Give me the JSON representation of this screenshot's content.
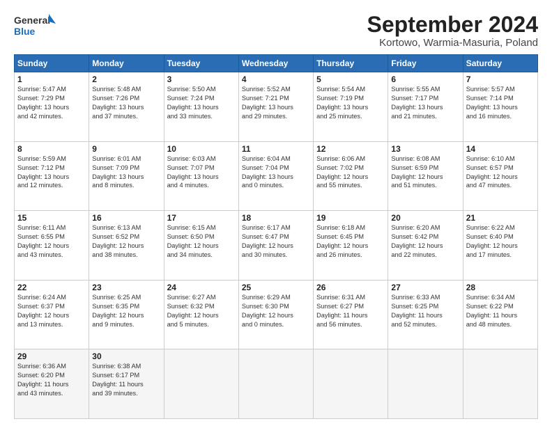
{
  "header": {
    "logo_line1": "General",
    "logo_line2": "Blue",
    "title": "September 2024",
    "subtitle": "Kortowo, Warmia-Masuria, Poland"
  },
  "weekdays": [
    "Sunday",
    "Monday",
    "Tuesday",
    "Wednesday",
    "Thursday",
    "Friday",
    "Saturday"
  ],
  "weeks": [
    [
      {
        "day": "1",
        "info": "Sunrise: 5:47 AM\nSunset: 7:29 PM\nDaylight: 13 hours\nand 42 minutes."
      },
      {
        "day": "2",
        "info": "Sunrise: 5:48 AM\nSunset: 7:26 PM\nDaylight: 13 hours\nand 37 minutes."
      },
      {
        "day": "3",
        "info": "Sunrise: 5:50 AM\nSunset: 7:24 PM\nDaylight: 13 hours\nand 33 minutes."
      },
      {
        "day": "4",
        "info": "Sunrise: 5:52 AM\nSunset: 7:21 PM\nDaylight: 13 hours\nand 29 minutes."
      },
      {
        "day": "5",
        "info": "Sunrise: 5:54 AM\nSunset: 7:19 PM\nDaylight: 13 hours\nand 25 minutes."
      },
      {
        "day": "6",
        "info": "Sunrise: 5:55 AM\nSunset: 7:17 PM\nDaylight: 13 hours\nand 21 minutes."
      },
      {
        "day": "7",
        "info": "Sunrise: 5:57 AM\nSunset: 7:14 PM\nDaylight: 13 hours\nand 16 minutes."
      }
    ],
    [
      {
        "day": "8",
        "info": "Sunrise: 5:59 AM\nSunset: 7:12 PM\nDaylight: 13 hours\nand 12 minutes."
      },
      {
        "day": "9",
        "info": "Sunrise: 6:01 AM\nSunset: 7:09 PM\nDaylight: 13 hours\nand 8 minutes."
      },
      {
        "day": "10",
        "info": "Sunrise: 6:03 AM\nSunset: 7:07 PM\nDaylight: 13 hours\nand 4 minutes."
      },
      {
        "day": "11",
        "info": "Sunrise: 6:04 AM\nSunset: 7:04 PM\nDaylight: 13 hours\nand 0 minutes."
      },
      {
        "day": "12",
        "info": "Sunrise: 6:06 AM\nSunset: 7:02 PM\nDaylight: 12 hours\nand 55 minutes."
      },
      {
        "day": "13",
        "info": "Sunrise: 6:08 AM\nSunset: 6:59 PM\nDaylight: 12 hours\nand 51 minutes."
      },
      {
        "day": "14",
        "info": "Sunrise: 6:10 AM\nSunset: 6:57 PM\nDaylight: 12 hours\nand 47 minutes."
      }
    ],
    [
      {
        "day": "15",
        "info": "Sunrise: 6:11 AM\nSunset: 6:55 PM\nDaylight: 12 hours\nand 43 minutes."
      },
      {
        "day": "16",
        "info": "Sunrise: 6:13 AM\nSunset: 6:52 PM\nDaylight: 12 hours\nand 38 minutes."
      },
      {
        "day": "17",
        "info": "Sunrise: 6:15 AM\nSunset: 6:50 PM\nDaylight: 12 hours\nand 34 minutes."
      },
      {
        "day": "18",
        "info": "Sunrise: 6:17 AM\nSunset: 6:47 PM\nDaylight: 12 hours\nand 30 minutes."
      },
      {
        "day": "19",
        "info": "Sunrise: 6:18 AM\nSunset: 6:45 PM\nDaylight: 12 hours\nand 26 minutes."
      },
      {
        "day": "20",
        "info": "Sunrise: 6:20 AM\nSunset: 6:42 PM\nDaylight: 12 hours\nand 22 minutes."
      },
      {
        "day": "21",
        "info": "Sunrise: 6:22 AM\nSunset: 6:40 PM\nDaylight: 12 hours\nand 17 minutes."
      }
    ],
    [
      {
        "day": "22",
        "info": "Sunrise: 6:24 AM\nSunset: 6:37 PM\nDaylight: 12 hours\nand 13 minutes."
      },
      {
        "day": "23",
        "info": "Sunrise: 6:25 AM\nSunset: 6:35 PM\nDaylight: 12 hours\nand 9 minutes."
      },
      {
        "day": "24",
        "info": "Sunrise: 6:27 AM\nSunset: 6:32 PM\nDaylight: 12 hours\nand 5 minutes."
      },
      {
        "day": "25",
        "info": "Sunrise: 6:29 AM\nSunset: 6:30 PM\nDaylight: 12 hours\nand 0 minutes."
      },
      {
        "day": "26",
        "info": "Sunrise: 6:31 AM\nSunset: 6:27 PM\nDaylight: 11 hours\nand 56 minutes."
      },
      {
        "day": "27",
        "info": "Sunrise: 6:33 AM\nSunset: 6:25 PM\nDaylight: 11 hours\nand 52 minutes."
      },
      {
        "day": "28",
        "info": "Sunrise: 6:34 AM\nSunset: 6:22 PM\nDaylight: 11 hours\nand 48 minutes."
      }
    ],
    [
      {
        "day": "29",
        "info": "Sunrise: 6:36 AM\nSunset: 6:20 PM\nDaylight: 11 hours\nand 43 minutes."
      },
      {
        "day": "30",
        "info": "Sunrise: 6:38 AM\nSunset: 6:17 PM\nDaylight: 11 hours\nand 39 minutes."
      },
      {
        "day": "",
        "info": ""
      },
      {
        "day": "",
        "info": ""
      },
      {
        "day": "",
        "info": ""
      },
      {
        "day": "",
        "info": ""
      },
      {
        "day": "",
        "info": ""
      }
    ]
  ]
}
